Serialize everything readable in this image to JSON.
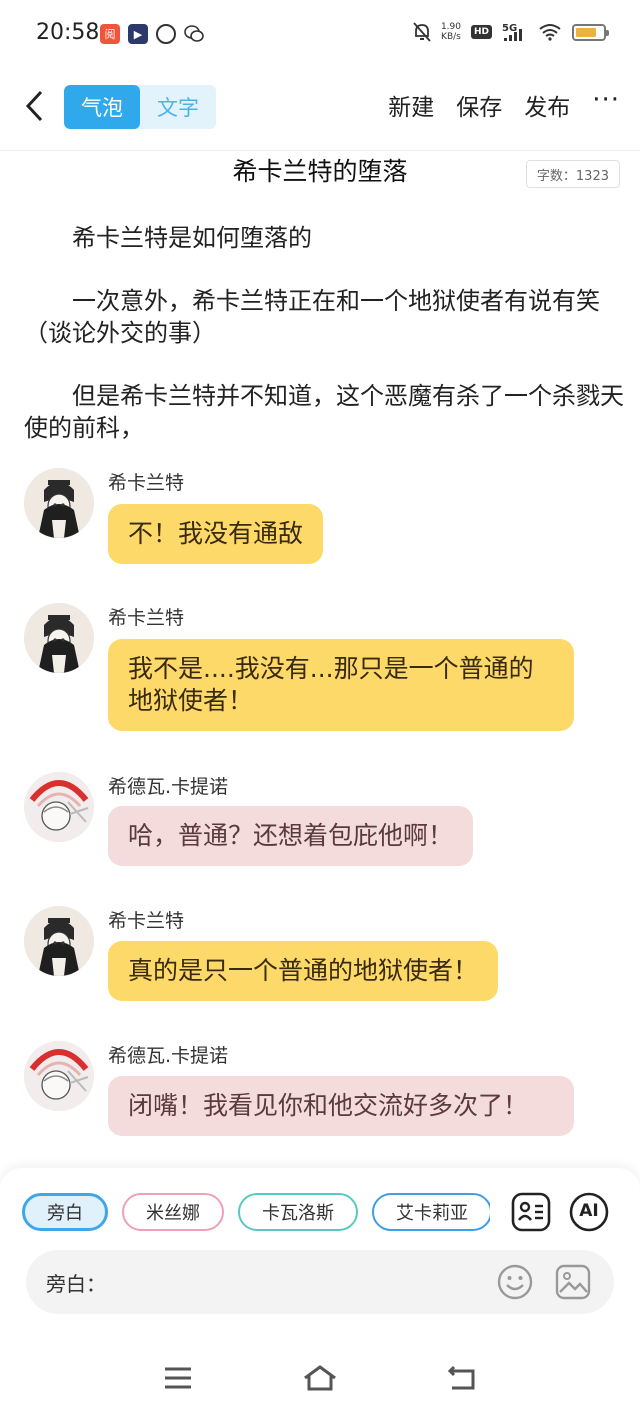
{
  "status": {
    "time": "20:58",
    "net_speed_value": "1.90",
    "net_speed_unit": "KB/s",
    "hd": "HD",
    "network": "5G",
    "battery_level": 0.65
  },
  "toolbar": {
    "mode_bubble": "气泡",
    "mode_text": "文字",
    "new_label": "新建",
    "save_label": "保存",
    "publish_label": "发布",
    "more_label": "···"
  },
  "doc": {
    "title": "希卡兰特的堕落",
    "word_count": "字数：1323"
  },
  "narration": [
    "希卡兰特是如何堕落的",
    "一次意外，希卡兰特正在和一个地狱使者有说有笑（谈论外交的事）",
    "但是希卡兰特并不知道，这个恶魔有杀了一个杀戮天使的前科，"
  ],
  "messages": [
    {
      "speaker": "希卡兰特",
      "text": "不！我没有通敌",
      "style": "yellow"
    },
    {
      "speaker": "希卡兰特",
      "text": "我不是....我没有...那只是一个普通的地狱使者！",
      "style": "yellow"
    },
    {
      "speaker": "希德瓦.卡提诺",
      "text": "哈，普通？还想着包庇他啊！",
      "style": "pink"
    },
    {
      "speaker": "希卡兰特",
      "text": "真的是只一个普通的地狱使者！",
      "style": "yellow"
    },
    {
      "speaker": "希德瓦.卡提诺",
      "text": "闭嘴！我看见你和他交流好多次了！",
      "style": "pink"
    }
  ],
  "composer": {
    "roles": [
      "旁白",
      "米丝娜",
      "卡瓦洛斯",
      "艾卡莉亚"
    ],
    "input_label": "旁白：",
    "input_value": "",
    "ai_label": "AI"
  },
  "colors": {
    "accent": "#2fa9ec",
    "bubble_yellow": "#fcd969",
    "bubble_pink": "#f4dcdc"
  }
}
